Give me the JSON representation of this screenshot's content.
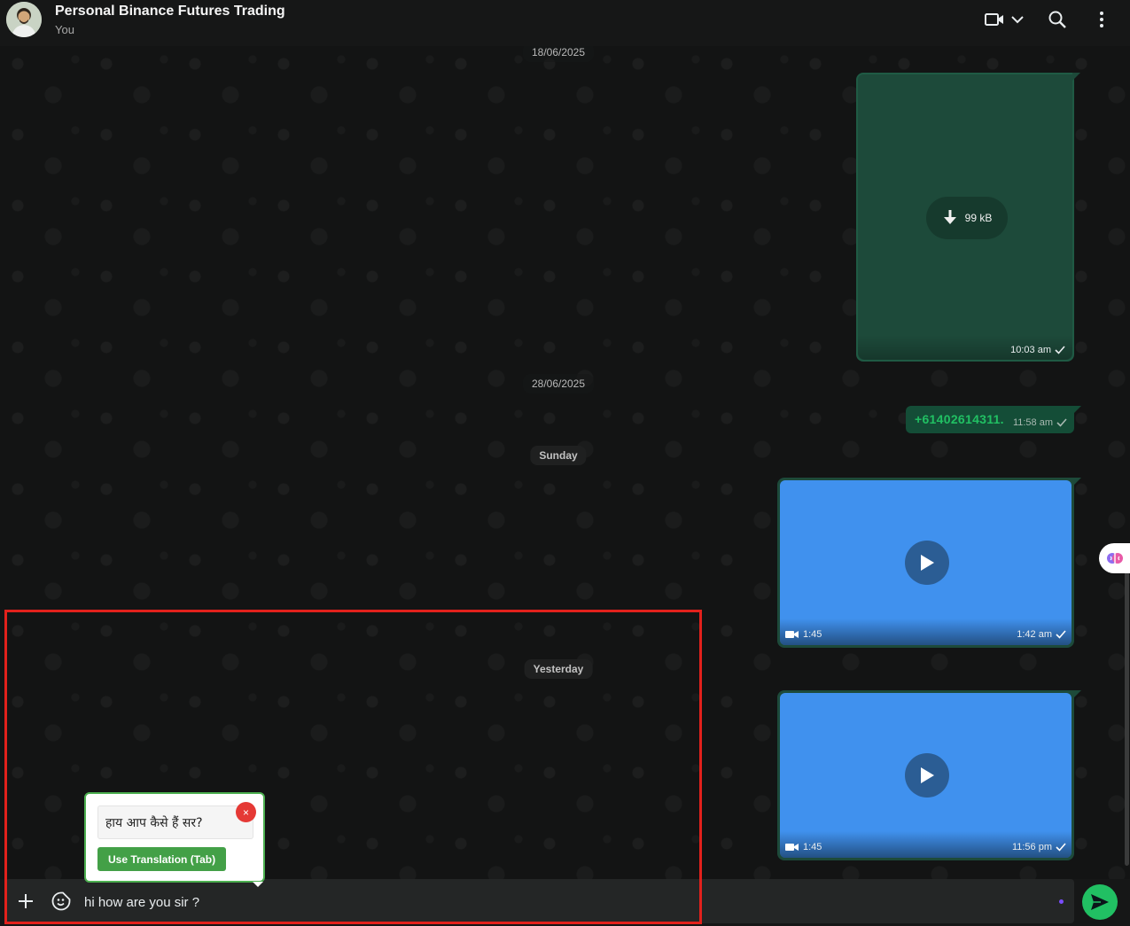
{
  "header": {
    "title": "Personal Binance Futures Trading",
    "subtitle": "You",
    "icons": [
      "video-call-icon",
      "chevron-down-icon",
      "search-icon",
      "more-vert-icon"
    ]
  },
  "dates": {
    "d1": "18/06/2025",
    "d2": "28/06/2025",
    "d3": "Sunday",
    "d4": "Yesterday"
  },
  "messages": {
    "doc": {
      "size": "99 kB",
      "time": "10:03 am",
      "status": "sent"
    },
    "phone": {
      "number": "+61402614311.",
      "time": "11:58 am",
      "status": "sent"
    },
    "video1": {
      "duration": "1:45",
      "time": "1:42 am",
      "status": "sent"
    },
    "video2": {
      "duration": "1:45",
      "time": "11:56 pm",
      "status": "sent"
    }
  },
  "translation_popup": {
    "translated_text": "हाय आप कैसे हैं सर?",
    "close_label": "×",
    "button_label": "Use Translation (Tab)"
  },
  "composer": {
    "input_value": "hi how are you sir ?",
    "icons": [
      "plus-icon",
      "sticker-icon",
      "send-icon"
    ]
  },
  "colors": {
    "accent": "#21c063",
    "outgoing_bubble": "#1d4a3a",
    "video_placeholder": "#4091ee",
    "annotation": "#e2211c"
  }
}
